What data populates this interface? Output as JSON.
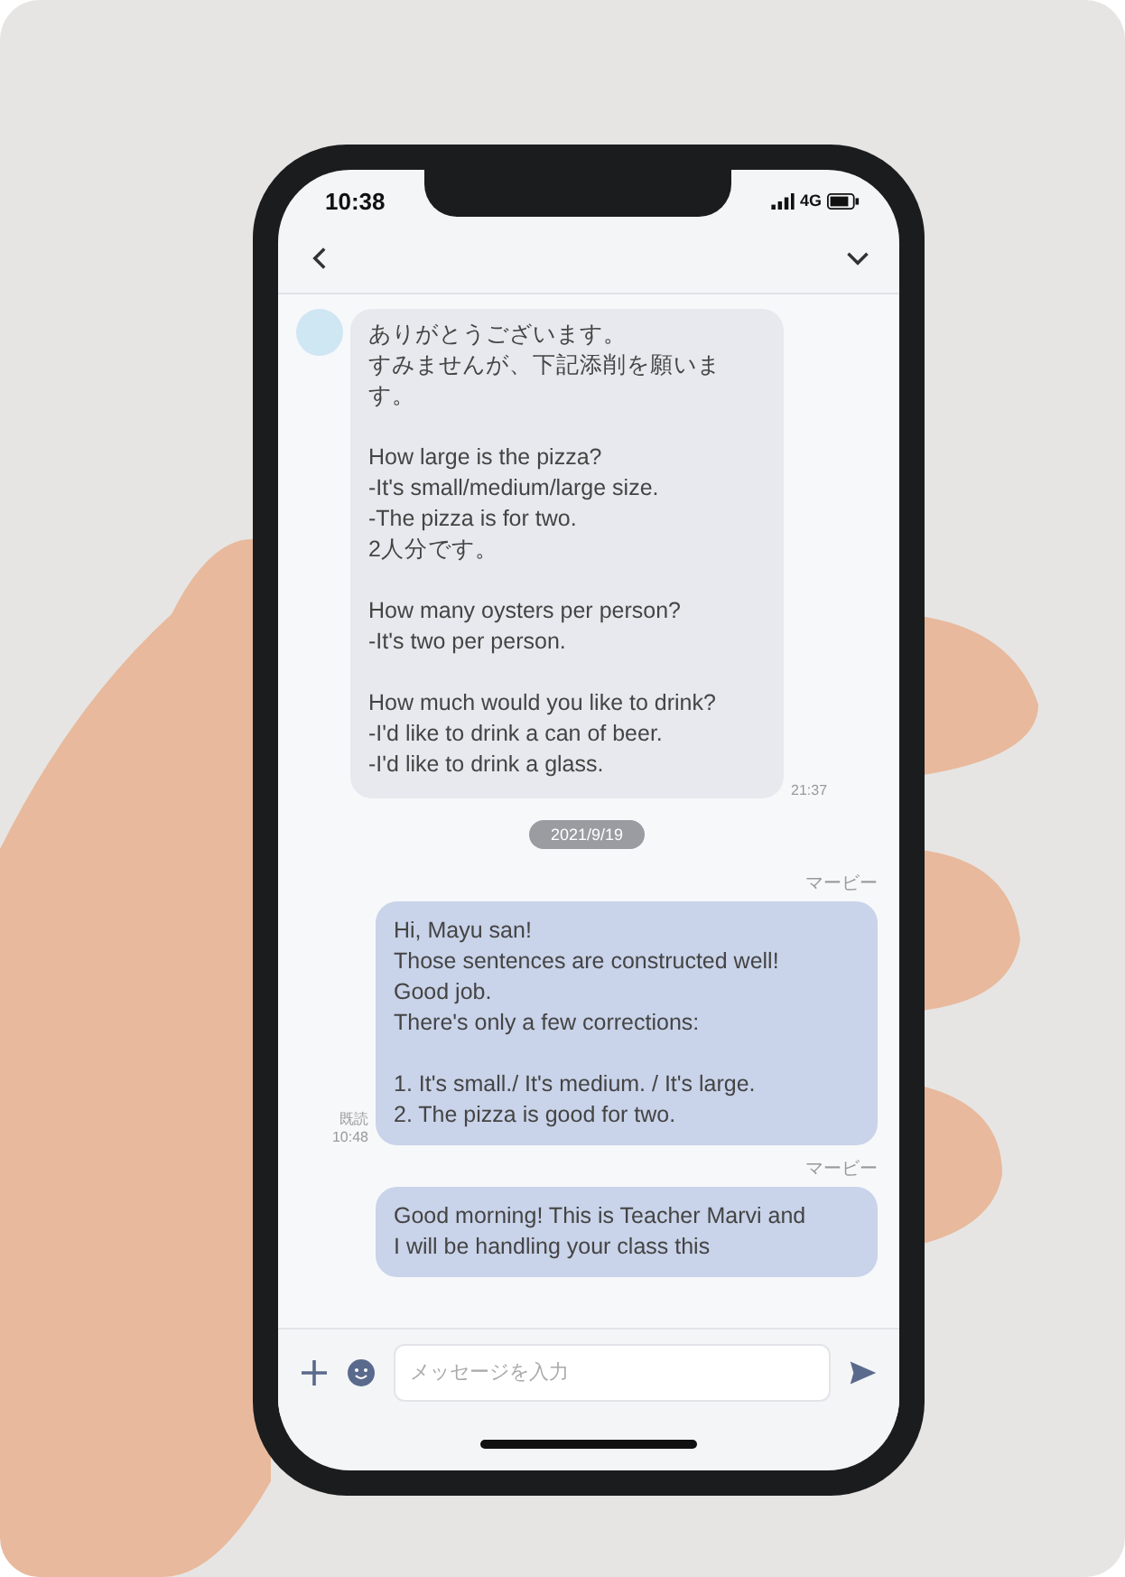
{
  "status_bar": {
    "time": "10:38",
    "network": "4G"
  },
  "chat": {
    "messages": [
      {
        "kind": "received",
        "paragraphs": [
          [
            "ありがとうございます。",
            "すみませんが、下記添削を願います。"
          ],
          [
            "How large is the pizza?",
            "-It's small/medium/large size.",
            "-The pizza is for two.",
            "2人分です。"
          ],
          [
            "How many oysters per person?",
            "-It's two per person."
          ],
          [
            "How much would you like to drink?",
            "-I'd like to drink a can of beer.",
            "-I'd like to drink a glass."
          ]
        ],
        "time": "21:37"
      },
      {
        "kind": "date",
        "text": "2021/9/19"
      },
      {
        "kind": "sent",
        "sender": "マービー",
        "text": "Hi, Mayu san!\nThose sentences are constructed well!\nGood job.\nThere's only a few corrections:\n\n1. It's small./ It's medium. / It's large.\n2. The pizza is good for two.",
        "read": "既読",
        "time": "10:48"
      },
      {
        "kind": "sent",
        "sender": "マービー",
        "text": "Good morning! This is Teacher Marvi and\nI will be handling your class this"
      }
    ]
  },
  "composer": {
    "placeholder": "メッセージを入力"
  }
}
